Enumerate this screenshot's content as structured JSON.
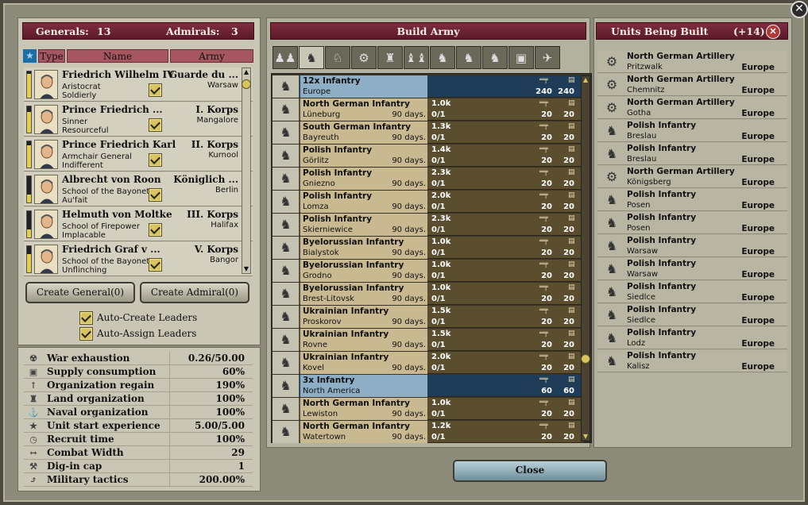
{
  "left": {
    "generals_label": "Generals:",
    "generals_count": "13",
    "admirals_label": "Admirals:",
    "admirals_count": "3",
    "cols": {
      "type": "Type",
      "name": "Name",
      "army": "Army"
    },
    "leaders": [
      {
        "name": "Friedrich Wilhelm IV",
        "trait1": "Aristocrat",
        "trait2": "Soldierly",
        "army": "Guarde du ...",
        "loc": "Warsaw",
        "prestige": 0.9
      },
      {
        "name": "Prince Friedrich ...",
        "trait1": "Sinner",
        "trait2": "Resourceful",
        "army": "I. Korps",
        "loc": "Mangalore",
        "prestige": 0.8
      },
      {
        "name": "Prince Friedrich Karl",
        "trait1": "Armchair General",
        "trait2": "Indifferent",
        "army": "II. Korps",
        "loc": "Kurnool",
        "prestige": 0.85
      },
      {
        "name": "Albrecht von Roon",
        "trait1": "School of the Bayonet",
        "trait2": "Au'fait",
        "army": "Königlich ...",
        "loc": "Berlin",
        "prestige": 0.3
      },
      {
        "name": "Helmuth von Moltke",
        "trait1": "School of Firepower",
        "trait2": "Implacable",
        "army": "III. Korps",
        "loc": "Halifax",
        "prestige": 0.3
      },
      {
        "name": "Friedrich Graf v ...",
        "trait1": "School of the Bayonet",
        "trait2": "Unflinching",
        "army": "V. Korps",
        "loc": "Bangor",
        "prestige": 0.7
      }
    ],
    "create_general": "Create General(0)",
    "create_admiral": "Create Admiral(0)",
    "auto_create": "Auto-Create Leaders",
    "auto_assign": "Auto-Assign Leaders",
    "stats": [
      {
        "icon": "war-exhaustion-icon",
        "glyph": "☢",
        "label": "War exhaustion",
        "value": "0.26/50.00"
      },
      {
        "icon": "supply-icon",
        "glyph": "▣",
        "label": "Supply consumption",
        "value": "60%"
      },
      {
        "icon": "organisation-icon",
        "glyph": "↑",
        "label": "Organization regain",
        "value": "190%"
      },
      {
        "icon": "land-org-icon",
        "glyph": "♜",
        "label": "Land organization",
        "value": "100%"
      },
      {
        "icon": "naval-org-icon",
        "glyph": "⚓",
        "label": "Naval organization",
        "value": "100%"
      },
      {
        "icon": "experience-icon",
        "glyph": "★",
        "label": "Unit start experience",
        "value": "5.00/5.00"
      },
      {
        "icon": "recruit-time-icon",
        "glyph": "◷",
        "label": "Recruit time",
        "value": "100%"
      },
      {
        "icon": "combat-width-icon",
        "glyph": "↔",
        "label": "Combat Width",
        "value": "29"
      },
      {
        "icon": "dig-in-icon",
        "glyph": "⚒",
        "label": "Dig-in cap",
        "value": "1"
      },
      {
        "icon": "tactics-icon",
        "glyph": "⤴",
        "label": "Military tactics",
        "value": "200.00%"
      }
    ]
  },
  "middle": {
    "title": "Build Army",
    "tabs": [
      "all-units-tab",
      "infantry-tab",
      "cavalry-tab",
      "artillery-tab",
      "engineer-tab",
      "guard-tab",
      "hussar-tab",
      "cuirassier-tab",
      "dragoon-tab",
      "armor-tab",
      "plane-tab"
    ],
    "units": [
      {
        "group": true,
        "name": "12x Infantry",
        "prov": "Europe",
        "v1": "240",
        "v2": "240"
      },
      {
        "name": "North German Infantry",
        "prov": "Lüneburg",
        "days": "90 days.",
        "cost": "1.0k",
        "ratio": "0/1",
        "v1": "20",
        "v2": "20"
      },
      {
        "name": "South German Infantry",
        "prov": "Bayreuth",
        "days": "90 days.",
        "cost": "1.3k",
        "ratio": "0/1",
        "v1": "20",
        "v2": "20"
      },
      {
        "name": "Polish Infantry",
        "prov": "Görlitz",
        "days": "90 days.",
        "cost": "1.4k",
        "ratio": "0/1",
        "v1": "20",
        "v2": "20"
      },
      {
        "name": "Polish Infantry",
        "prov": "Gniezno",
        "days": "90 days.",
        "cost": "2.3k",
        "ratio": "0/1",
        "v1": "20",
        "v2": "20"
      },
      {
        "name": "Polish Infantry",
        "prov": "Lomza",
        "days": "90 days.",
        "cost": "2.0k",
        "ratio": "0/1",
        "v1": "20",
        "v2": "20"
      },
      {
        "name": "Polish Infantry",
        "prov": "Skierniewice",
        "days": "90 days.",
        "cost": "2.3k",
        "ratio": "0/1",
        "v1": "20",
        "v2": "20"
      },
      {
        "name": "Byelorussian Infantry",
        "prov": "Bialystok",
        "days": "90 days.",
        "cost": "1.0k",
        "ratio": "0/1",
        "v1": "20",
        "v2": "20"
      },
      {
        "name": "Byelorussian Infantry",
        "prov": "Grodno",
        "days": "90 days.",
        "cost": "1.0k",
        "ratio": "0/1",
        "v1": "20",
        "v2": "20"
      },
      {
        "name": "Byelorussian Infantry",
        "prov": "Brest-Litovsk",
        "days": "90 days.",
        "cost": "1.0k",
        "ratio": "0/1",
        "v1": "20",
        "v2": "20"
      },
      {
        "name": "Ukrainian Infantry",
        "prov": "Proskorov",
        "days": "90 days.",
        "cost": "1.5k",
        "ratio": "0/1",
        "v1": "20",
        "v2": "20"
      },
      {
        "name": "Ukrainian Infantry",
        "prov": "Rovne",
        "days": "90 days.",
        "cost": "1.5k",
        "ratio": "0/1",
        "v1": "20",
        "v2": "20"
      },
      {
        "name": "Ukrainian Infantry",
        "prov": "Kovel",
        "days": "90 days.",
        "cost": "2.0k",
        "ratio": "0/1",
        "v1": "20",
        "v2": "20"
      },
      {
        "group": true,
        "name": "3x Infantry",
        "prov": "North America",
        "v1": "60",
        "v2": "60"
      },
      {
        "name": "North German Infantry",
        "prov": "Lewiston",
        "days": "90 days.",
        "cost": "1.0k",
        "ratio": "0/1",
        "v1": "20",
        "v2": "20"
      },
      {
        "name": "North German Infantry",
        "prov": "Watertown",
        "days": "90 days.",
        "cost": "1.2k",
        "ratio": "0/1",
        "v1": "20",
        "v2": "20"
      }
    ],
    "close": "Close"
  },
  "right": {
    "title": "Units Being Built",
    "count": "(+14)",
    "items": [
      {
        "art": true,
        "name": "North German Artillery",
        "prov": "Pritzwalk",
        "region": "Europe"
      },
      {
        "art": true,
        "name": "North German Artillery",
        "prov": "Chemnitz",
        "region": "Europe"
      },
      {
        "art": true,
        "name": "North German Artillery",
        "prov": "Gotha",
        "region": "Europe"
      },
      {
        "name": "Polish Infantry",
        "prov": "Breslau",
        "region": "Europe"
      },
      {
        "name": "Polish Infantry",
        "prov": "Breslau",
        "region": "Europe"
      },
      {
        "art": true,
        "name": "North German Artillery",
        "prov": "Königsberg",
        "region": "Europe"
      },
      {
        "name": "Polish Infantry",
        "prov": "Posen",
        "region": "Europe"
      },
      {
        "name": "Polish Infantry",
        "prov": "Posen",
        "region": "Europe"
      },
      {
        "name": "Polish Infantry",
        "prov": "Warsaw",
        "region": "Europe"
      },
      {
        "name": "Polish Infantry",
        "prov": "Warsaw",
        "region": "Europe"
      },
      {
        "name": "Polish Infantry",
        "prov": "Siedlce",
        "region": "Europe"
      },
      {
        "name": "Polish Infantry",
        "prov": "Siedlce",
        "region": "Europe"
      },
      {
        "name": "Polish Infantry",
        "prov": "Lodz",
        "region": "Europe"
      },
      {
        "name": "Polish Infantry",
        "prov": "Kalisz",
        "region": "Europe"
      }
    ]
  }
}
